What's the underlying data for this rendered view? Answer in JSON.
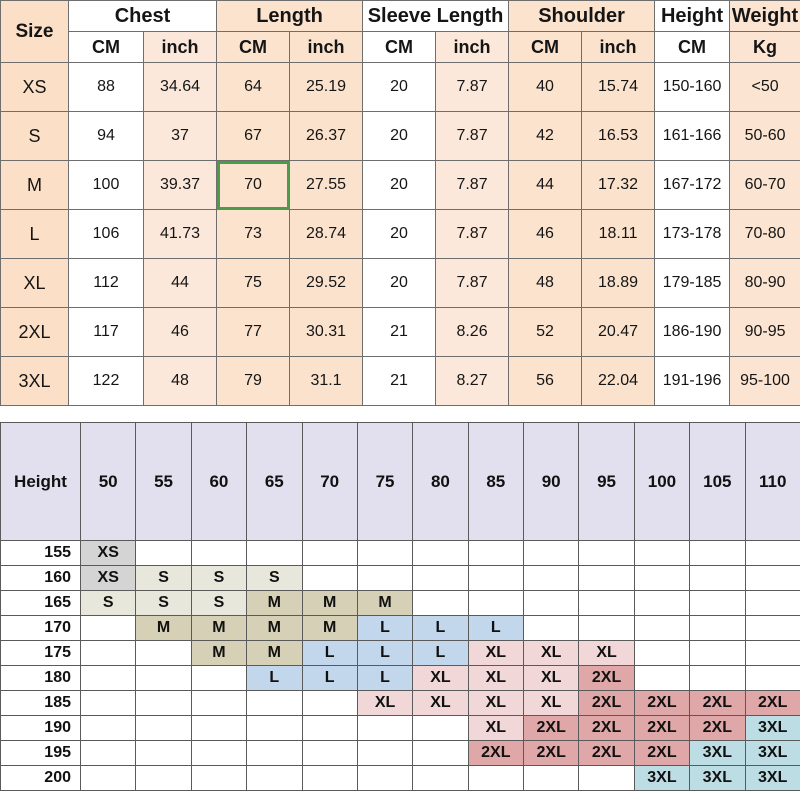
{
  "size_table": {
    "corner_label": "Size",
    "groups": [
      {
        "name": "Chest",
        "units": [
          "CM",
          "inch"
        ]
      },
      {
        "name": "Length",
        "units": [
          "CM",
          "inch"
        ]
      },
      {
        "name": "Sleeve Length",
        "units": [
          "CM",
          "inch"
        ]
      },
      {
        "name": "Shoulder",
        "units": [
          "CM",
          "inch"
        ]
      },
      {
        "name": "Height",
        "units": [
          "CM"
        ]
      },
      {
        "name": "Weight",
        "units": [
          "Kg"
        ]
      }
    ],
    "rows": [
      {
        "size": "XS",
        "chest_cm": "88",
        "chest_in": "34.64",
        "length_cm": "64",
        "length_in": "25.19",
        "sleeve_cm": "20",
        "sleeve_in": "7.87",
        "shoulder_cm": "40",
        "shoulder_in": "15.74",
        "height_cm": "150-160",
        "weight_kg": "<50"
      },
      {
        "size": "S",
        "chest_cm": "94",
        "chest_in": "37",
        "length_cm": "67",
        "length_in": "26.37",
        "sleeve_cm": "20",
        "sleeve_in": "7.87",
        "shoulder_cm": "42",
        "shoulder_in": "16.53",
        "height_cm": "161-166",
        "weight_kg": "50-60"
      },
      {
        "size": "M",
        "chest_cm": "100",
        "chest_in": "39.37",
        "length_cm": "70",
        "length_in": "27.55",
        "sleeve_cm": "20",
        "sleeve_in": "7.87",
        "shoulder_cm": "44",
        "shoulder_in": "17.32",
        "height_cm": "167-172",
        "weight_kg": "60-70"
      },
      {
        "size": "L",
        "chest_cm": "106",
        "chest_in": "41.73",
        "length_cm": "73",
        "length_in": "28.74",
        "sleeve_cm": "20",
        "sleeve_in": "7.87",
        "shoulder_cm": "46",
        "shoulder_in": "18.11",
        "height_cm": "173-178",
        "weight_kg": "70-80"
      },
      {
        "size": "XL",
        "chest_cm": "112",
        "chest_in": "44",
        "length_cm": "75",
        "length_in": "29.52",
        "sleeve_cm": "20",
        "sleeve_in": "7.87",
        "shoulder_cm": "48",
        "shoulder_in": "18.89",
        "height_cm": "179-185",
        "weight_kg": "80-90"
      },
      {
        "size": "2XL",
        "chest_cm": "117",
        "chest_in": "46",
        "length_cm": "77",
        "length_in": "30.31",
        "sleeve_cm": "21",
        "sleeve_in": "8.26",
        "shoulder_cm": "52",
        "shoulder_in": "20.47",
        "height_cm": "186-190",
        "weight_kg": "90-95"
      },
      {
        "size": "3XL",
        "chest_cm": "122",
        "chest_in": "48",
        "length_cm": "79",
        "length_in": "31.1",
        "sleeve_cm": "21",
        "sleeve_in": "8.27",
        "shoulder_cm": "56",
        "shoulder_in": "22.04",
        "height_cm": "191-196",
        "weight_kg": "95-100"
      }
    ],
    "selected_cell": {
      "row": "M",
      "column": "length_cm",
      "value": "70",
      "highlight_color": "#4a9c4a"
    }
  },
  "matrix_table": {
    "corner_label": "Height",
    "weight_columns": [
      "50",
      "55",
      "60",
      "65",
      "70",
      "75",
      "80",
      "85",
      "90",
      "95",
      "100",
      "105",
      "110"
    ],
    "height_rows": [
      "155",
      "160",
      "165",
      "170",
      "175",
      "180",
      "185",
      "190",
      "195",
      "200"
    ],
    "cells": [
      [
        "XS",
        "",
        "",
        "",
        "",
        "",
        "",
        "",
        "",
        "",
        "",
        "",
        ""
      ],
      [
        "XS",
        "S",
        "S",
        "S",
        "",
        "",
        "",
        "",
        "",
        "",
        "",
        "",
        ""
      ],
      [
        "S",
        "S",
        "S",
        "M",
        "M",
        "M",
        "",
        "",
        "",
        "",
        "",
        "",
        ""
      ],
      [
        "",
        "M",
        "M",
        "M",
        "M",
        "L",
        "L",
        "L",
        "",
        "",
        "",
        "",
        ""
      ],
      [
        "",
        "",
        "M",
        "M",
        "L",
        "L",
        "L",
        "XL",
        "XL",
        "XL",
        "",
        "",
        ""
      ],
      [
        "",
        "",
        "",
        "L",
        "L",
        "L",
        "XL",
        "XL",
        "XL",
        "2XL",
        "",
        "",
        ""
      ],
      [
        "",
        "",
        "",
        "",
        "",
        "XL",
        "XL",
        "XL",
        "XL",
        "2XL",
        "2XL",
        "2XL",
        "2XL"
      ],
      [
        "",
        "",
        "",
        "",
        "",
        "",
        "",
        "XL",
        "2XL",
        "2XL",
        "2XL",
        "2XL",
        "3XL"
      ],
      [
        "",
        "",
        "",
        "",
        "",
        "",
        "",
        "2XL",
        "2XL",
        "2XL",
        "2XL",
        "3XL",
        "3XL"
      ],
      [
        "",
        "",
        "",
        "",
        "",
        "",
        "",
        "",
        "",
        "",
        "3XL",
        "3XL",
        "3XL"
      ]
    ],
    "legend_colors": {
      "XS": "#d4d4d4",
      "S": "#e8e7dc",
      "M": "#d6d1b6",
      "L": "#c2d6ec",
      "XL": "#f2d7d8",
      "2XL": "#dfa7a7",
      "3XL": "#bddde4",
      "header": "#e2dfee"
    }
  }
}
